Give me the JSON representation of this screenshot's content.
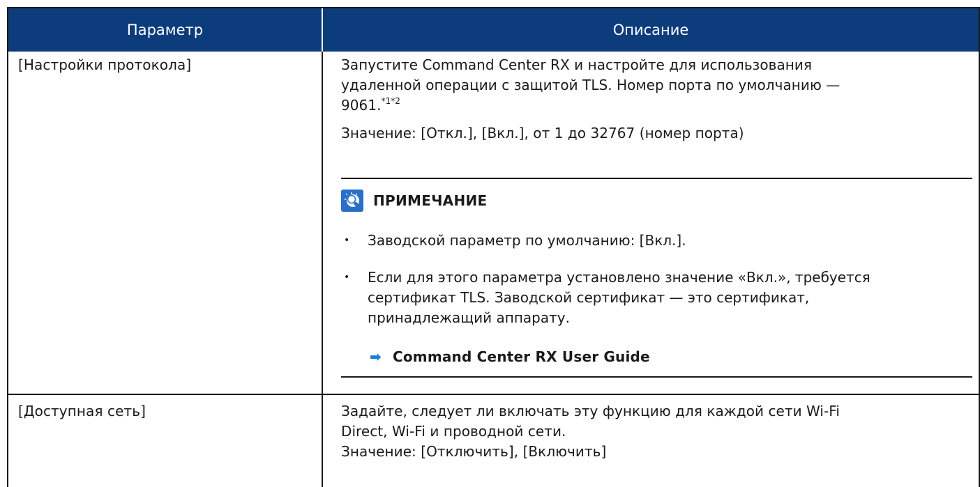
{
  "table": {
    "headers": {
      "param": "Параметр",
      "desc": "Описание"
    },
    "rows": [
      {
        "param": "[Настройки протокола]",
        "desc_line1": "Запустите Command Center RX и настройте для использования",
        "desc_line2": "удаленной операции с защитой TLS. Номер порта по умолчанию —",
        "desc_line3": "9061.",
        "footnotes": "*1*2",
        "value": "Значение: [Откл.], [Вкл.], от 1 до 32767 (номер порта)",
        "note": {
          "icon": "lightbulb-note-icon",
          "title": "ПРИМЕЧАНИЕ",
          "bullets": [
            {
              "lines": [
                "Заводской параметр по умолчанию: [Вкл.]."
              ]
            },
            {
              "lines": [
                "Если для этого параметра установлено значение «Вкл.», требуется",
                "сертификат TLS. Заводской сертификат — это сертификат,",
                "принадлежащий аппарату."
              ]
            }
          ],
          "reference": "Command Center RX User Guide"
        }
      },
      {
        "param": "[Доступная сеть]",
        "desc_line1": "Задайте, следует ли включать эту функцию для каждой сети Wi-Fi",
        "desc_line2": "Direct, Wi-Fi и проводной сети.",
        "value": "Значение: [Отключить], [Включить]"
      }
    ]
  },
  "colors": {
    "header_bg": "#0c3c7c",
    "arrow": "#1a7fd6",
    "text": "#1a1a1a"
  }
}
